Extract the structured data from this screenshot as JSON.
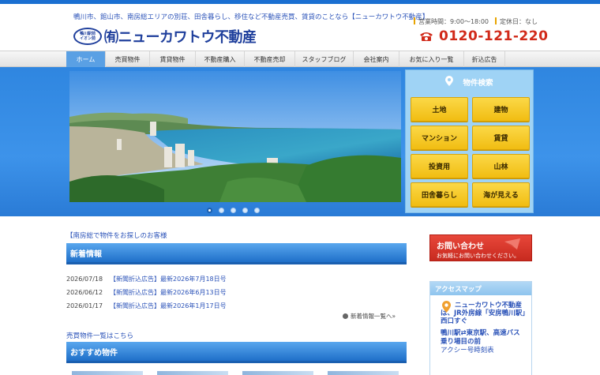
{
  "header": {
    "tagline": "鴨川市、館山市、南房総エリアの別荘、田舎暮らし、移住など不動産売買、賃貸のことなら【ニューカワトウ不動産】",
    "logo_badge": "鴨川駅前\nイオン前",
    "logo_text": "㈲ニューカワトウ不動産",
    "hours": "営業時間：9:00～18:00",
    "holiday": "定休日：なし",
    "phone": "0120-121-220"
  },
  "nav": {
    "items": [
      {
        "label": "ホーム",
        "active": true
      },
      {
        "label": "売買物件"
      },
      {
        "label": "賃貸物件"
      },
      {
        "label": "不動産購入"
      },
      {
        "label": "不動産売却"
      },
      {
        "label": "スタッフブログ"
      },
      {
        "label": "会社案内"
      },
      {
        "label": "お気に入り一覧"
      },
      {
        "label": "折込広告"
      }
    ]
  },
  "slider": {
    "dots": 5,
    "active_index": 0
  },
  "search": {
    "title": "物件検索",
    "buttons": [
      "土地",
      "建物",
      "マンション",
      "賃貸",
      "投資用",
      "山林",
      "田舎暮らし",
      "海が見える"
    ]
  },
  "main": {
    "intro_link": "【南房総で物件をお探しのお客様",
    "news_heading": "新着情報",
    "news": [
      {
        "date": "2026/07/18",
        "title": "【新聞折込広告】最新2026年7月18日号"
      },
      {
        "date": "2026/06/12",
        "title": "【新聞折込広告】最新2026年6月13日号"
      },
      {
        "date": "2026/01/17",
        "title": "【新聞折込広告】最新2026年1月17日号"
      }
    ],
    "news_more": "新着情報一覧へ»",
    "sale_link": "売買物件一覧はこちら",
    "recommended_heading": "おすすめ物件"
  },
  "sidebar": {
    "contact_title": "お問い合わせ",
    "contact_sub": "お気軽にお問い合わせください。",
    "access_heading": "アクセスマップ",
    "access_name": "ニューカワトウ不動産",
    "access_addr": "は、JR外房線「安房鴨川駅」西口すぐ",
    "access_route": "鴨川駅⇄東京駅、高速バス乗り場目の前",
    "access_bus": "アクシー号時刻表"
  },
  "colors": {
    "brand_blue": "#1f3f9c",
    "hero_blue": "#3d93ea",
    "button_yellow": "#f1bd12",
    "phone_red": "#d12a1a"
  }
}
